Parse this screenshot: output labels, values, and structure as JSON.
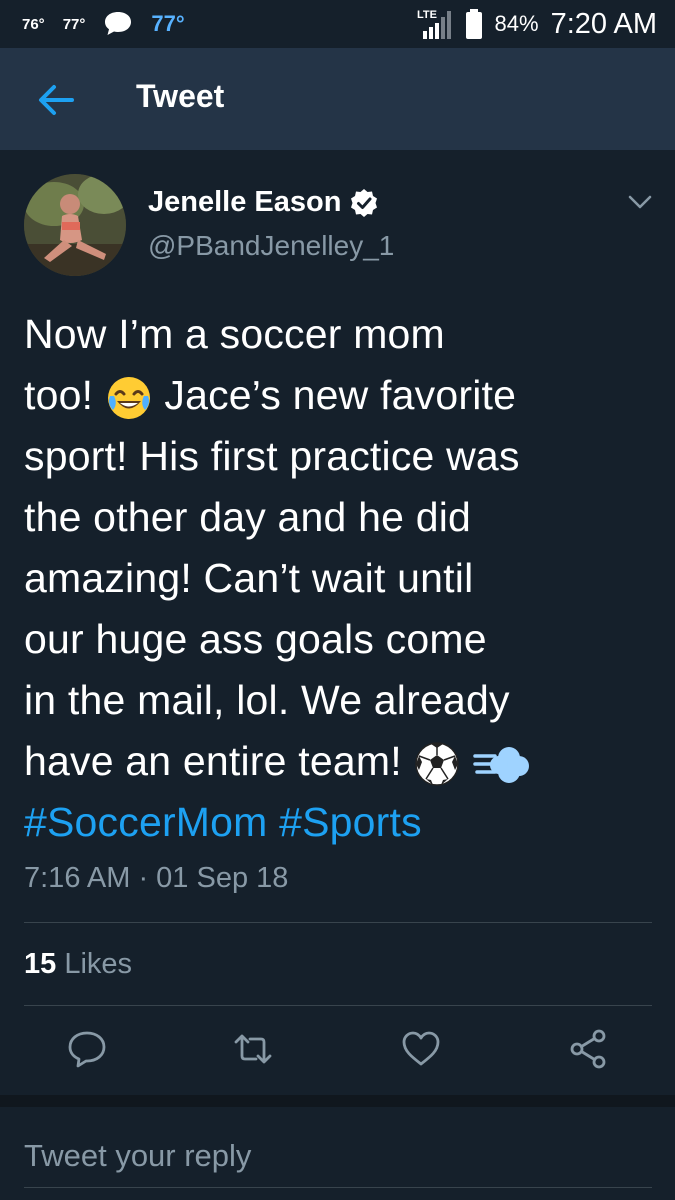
{
  "status_bar": {
    "temp_1": "76°",
    "temp_2": "77°",
    "temp_3": "77°",
    "network": "LTE",
    "battery": "84%",
    "time": "7:20 AM"
  },
  "header": {
    "title": "Tweet",
    "back_icon": "arrow-left-icon"
  },
  "tweet": {
    "author_name": "Jenelle Eason",
    "handle": "@PBandJenelley_1",
    "lines": [
      "Now I’m a soccer mom",
      "too!",
      "Jace’s new favorite",
      "sport! His first practice was",
      "the other day and he did",
      "amazing! Can’t wait until",
      "our huge ass goals come",
      "in the mail, lol. We already",
      "have an entire team!"
    ],
    "hashtags": [
      "#SoccerMom",
      "#Sports"
    ],
    "timestamp": "7:16 AM · 01 Sep 18",
    "likes_count": "15",
    "likes_label": "Likes"
  },
  "actions": [
    "reply-icon",
    "retweet-icon",
    "like-icon",
    "share-icon"
  ],
  "reply": {
    "placeholder": "Tweet your reply"
  },
  "colors": {
    "background": "#15202b",
    "header": "#243447",
    "accent": "#1da1f2",
    "muted": "#8899a6"
  }
}
